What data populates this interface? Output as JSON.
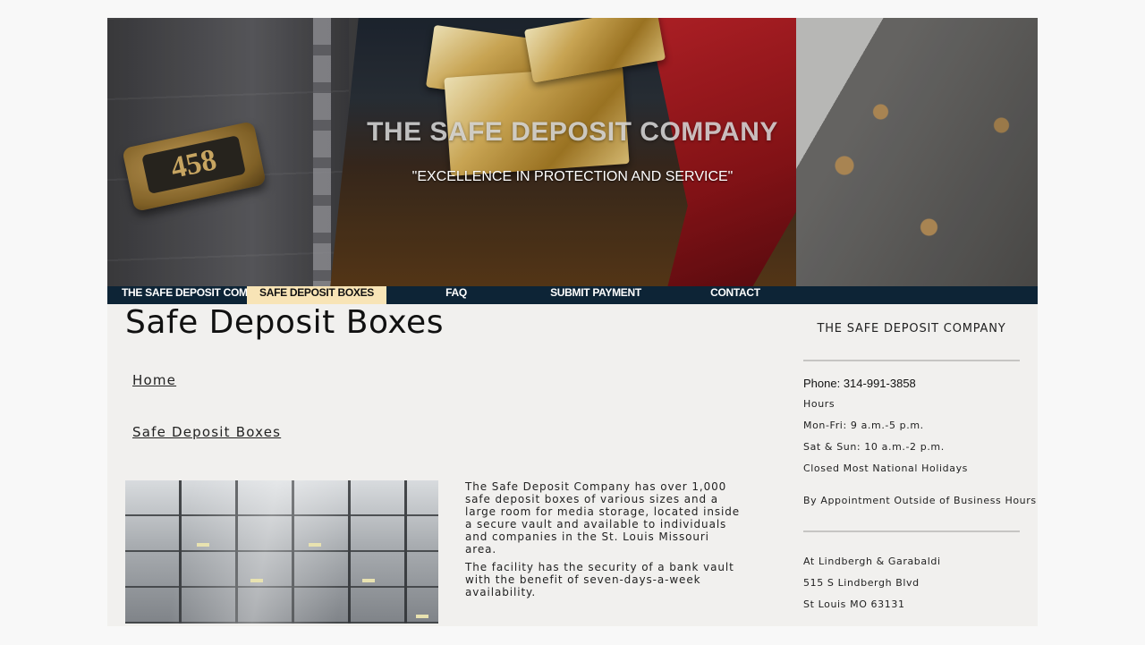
{
  "hero": {
    "title": "THE SAFE DEPOSIT COMPANY",
    "tagline": "\"EXCELLENCE IN PROTECTION AND SERVICE\"",
    "plate_number": "458"
  },
  "nav": {
    "items": [
      {
        "label": "THE SAFE DEPOSIT COMPANY"
      },
      {
        "label": "SAFE DEPOSIT BOXES"
      },
      {
        "label": "FAQ"
      },
      {
        "label": "SUBMIT PAYMENT"
      },
      {
        "label": "CONTACT"
      }
    ],
    "active": "SAFE DEPOSIT BOXES",
    "colors": {
      "bar": "#0d2436",
      "active": "#f8e4b6"
    }
  },
  "main": {
    "title": "Safe Deposit Boxes",
    "breadcrumbs": [
      "Home",
      "Safe Deposit Boxes"
    ],
    "paragraphs": [
      "The Safe Deposit Company has over 1,000 safe deposit boxes of various sizes and a large room for media storage, located inside a secure vault and available to individuals and companies in the St. Louis Missouri area.",
      "The facility has the security of a bank vault with the benefit of seven-days-a-week availability."
    ]
  },
  "sidebar": {
    "company": "THE SAFE DEPOSIT COMPANY",
    "phone": "Phone: 314-991-3858",
    "hours_heading": "Hours",
    "hours": [
      "Mon-Fri: 9 a.m.-5 p.m.",
      "Sat & Sun: 10 a.m.-2 p.m.",
      "Closed Most National Holidays"
    ],
    "appointment": "By Appointment Outside of Business Hours",
    "address": [
      "At Lindbergh & Garabaldi",
      "515 S Lindbergh Blvd",
      "St Louis MO 63131"
    ]
  }
}
